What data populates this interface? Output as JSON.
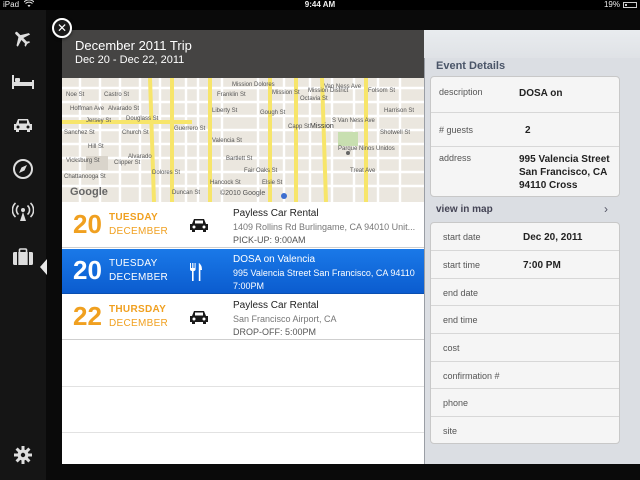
{
  "status_bar": {
    "carrier": "iPad",
    "time": "9:44 AM",
    "battery": "19%"
  },
  "sidebar": {
    "items": [
      {
        "icon": "airplane-icon"
      },
      {
        "icon": "bed-icon"
      },
      {
        "icon": "car-icon"
      },
      {
        "icon": "compass-icon"
      },
      {
        "icon": "broadcast-icon"
      },
      {
        "icon": "briefcase-icon",
        "active": true
      }
    ],
    "settings_icon": "gear-icon"
  },
  "trip": {
    "title": "December 2011 Trip",
    "dates": "Dec 20 - Dec 22, 2011"
  },
  "map": {
    "streets": [
      "Franklin St",
      "Gough St",
      "Octavia St",
      "Guerrero St",
      "Valencia St",
      "Mission St",
      "Capp St",
      "Van Ness Ave",
      "S Van Ness Ave",
      "Shotwell St",
      "Folsom St",
      "Harrison St",
      "Treat Ave",
      "Hill St",
      "Church St",
      "Sanchez St",
      "Noe St",
      "Castro St",
      "Dolores St",
      "Bartlett St",
      "Fair Oaks St",
      "Alvarado St",
      "Jersey St",
      "Hoffman Ave",
      "Douglass St",
      "Clipper St",
      "Chattanooga St",
      "Alvarado",
      "Liberty St",
      "Hancock St",
      "Mission",
      "Parque Ninos Unidos",
      "Mission District",
      "Mission Dolores",
      "Duncan St",
      "Elsie St",
      "Vicksburg St"
    ],
    "logo": "Google",
    "copyright": "©2010 Google"
  },
  "events": [
    {
      "day": "20",
      "weekday": "TUESDAY",
      "month": "DECEMBER",
      "icon": "car-icon",
      "title": "Payless Car Rental",
      "address": "1409 Rollins Rd Burlingame, CA 94010 Unit...",
      "time": "PICK-UP: 9:00AM",
      "selected": false
    },
    {
      "day": "20",
      "weekday": "TUESDAY",
      "month": "DECEMBER",
      "icon": "restaurant-icon",
      "title": "DOSA on Valencia",
      "address": "995 Valencia Street San Francisco, CA 94110",
      "time": "7:00PM",
      "selected": true
    },
    {
      "day": "22",
      "weekday": "THURSDAY",
      "month": "DECEMBER",
      "icon": "car-icon",
      "title": "Payless Car Rental",
      "address": "San Francisco Airport, CA",
      "time": "DROP-OFF: 5:00PM",
      "selected": false
    }
  ],
  "details": {
    "header": "Event Details",
    "card1": [
      {
        "label": "description",
        "value": "DOSA on"
      },
      {
        "label": "# guests",
        "value": "2"
      },
      {
        "label": "address",
        "value": "995 Valencia Street San Francisco, CA 94110 Cross"
      }
    ],
    "view_map": "view in map",
    "card2": [
      {
        "label": "start date",
        "value": "Dec 20, 2011"
      },
      {
        "label": "start time",
        "value": "7:00 PM"
      },
      {
        "label": "end date",
        "value": ""
      },
      {
        "label": "end time",
        "value": ""
      },
      {
        "label": "cost",
        "value": ""
      },
      {
        "label": "confirmation #",
        "value": ""
      },
      {
        "label": "phone",
        "value": ""
      },
      {
        "label": "site",
        "value": ""
      }
    ]
  },
  "colors": {
    "accent_orange": "#f0a020",
    "selection_blue": "#0b5ccf",
    "sidebar": "#151515"
  }
}
